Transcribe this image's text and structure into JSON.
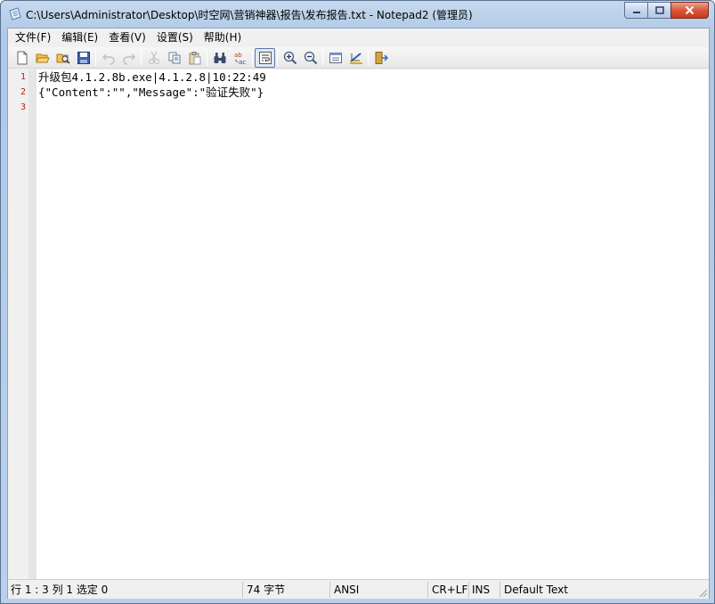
{
  "window": {
    "title": "C:\\Users\\Administrator\\Desktop\\时空网\\营销神器\\报告\\发布报告.txt - Notepad2 (管理员)"
  },
  "menu": [
    "文件(F)",
    "编辑(E)",
    "查看(V)",
    "设置(S)",
    "帮助(H)"
  ],
  "toolbar": {
    "icons": [
      "new-icon",
      "open-icon",
      "find-file-icon",
      "save-icon",
      "undo-icon",
      "redo-icon",
      "cut-icon",
      "copy-icon",
      "paste-icon",
      "find-icon",
      "replace-icon",
      "word-wrap-icon",
      "zoom-in-icon",
      "zoom-out-icon",
      "scheme-icon",
      "customize-icon",
      "exit-icon"
    ]
  },
  "editor": {
    "line_numbers": [
      "1",
      "2",
      "3"
    ],
    "lines": [
      "升级包4.1.2.8b.exe|4.1.2.8|10:22:49",
      "{\"Content\":\"\",\"Message\":\"验证失败\"}",
      ""
    ]
  },
  "statusbar": {
    "position": "行 1 : 3   列 1   选定 0",
    "size": "74 字节",
    "encoding": "ANSI",
    "line_ending": "CR+LF",
    "mode": "INS",
    "scheme": "Default Text"
  },
  "colors": {
    "line_number": "#c81414",
    "titlebar": "#c6d9ee",
    "close_button": "#d9573b"
  }
}
